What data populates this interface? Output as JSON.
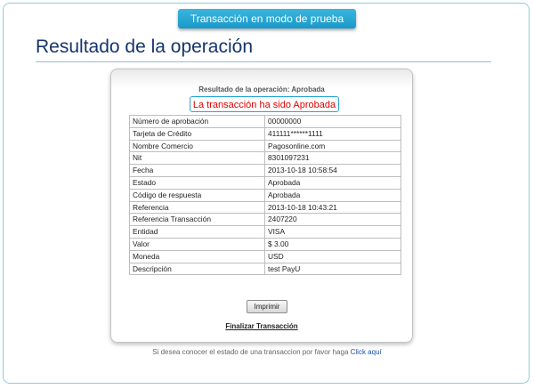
{
  "banner": {
    "label": "Transacción en modo de prueba"
  },
  "page": {
    "title": "Resultado de la operación"
  },
  "card": {
    "heading": "Resultado de la operación: Aprobada",
    "status_message": "La transacción ha sido Aprobada",
    "rows": [
      {
        "label": "Número de aprobación",
        "value": "00000000"
      },
      {
        "label": "Tarjeta de Crédito",
        "value": "411111******1111"
      },
      {
        "label": "Nombre Comercio",
        "value": "Pagosonline.com"
      },
      {
        "label": "Nit",
        "value": "8301097231"
      },
      {
        "label": "Fecha",
        "value": "2013-10-18 10:58:54"
      },
      {
        "label": "Estado",
        "value": "Aprobada"
      },
      {
        "label": "Código de respuesta",
        "value": "Aprobada"
      },
      {
        "label": "Referencia",
        "value": "2013-10-18 10:43:21"
      },
      {
        "label": "Referencia Transacción",
        "value": "2407220"
      },
      {
        "label": "Entidad",
        "value": "VISA"
      },
      {
        "label": "Valor",
        "value": "$ 3.00"
      },
      {
        "label": "Moneda",
        "value": "USD"
      },
      {
        "label": "Descripción",
        "value": "test PayU"
      }
    ],
    "print_label": "Imprimir",
    "finish_label": "Finalizar Transacción"
  },
  "footer": {
    "text": "Si desea conocer el estado de una transaccion por favor haga ",
    "link_label": "Click aquí"
  },
  "colors": {
    "accent": "#1a98c9",
    "title": "#14356b",
    "error_red": "#e00000",
    "link": "#1a4fb0"
  }
}
